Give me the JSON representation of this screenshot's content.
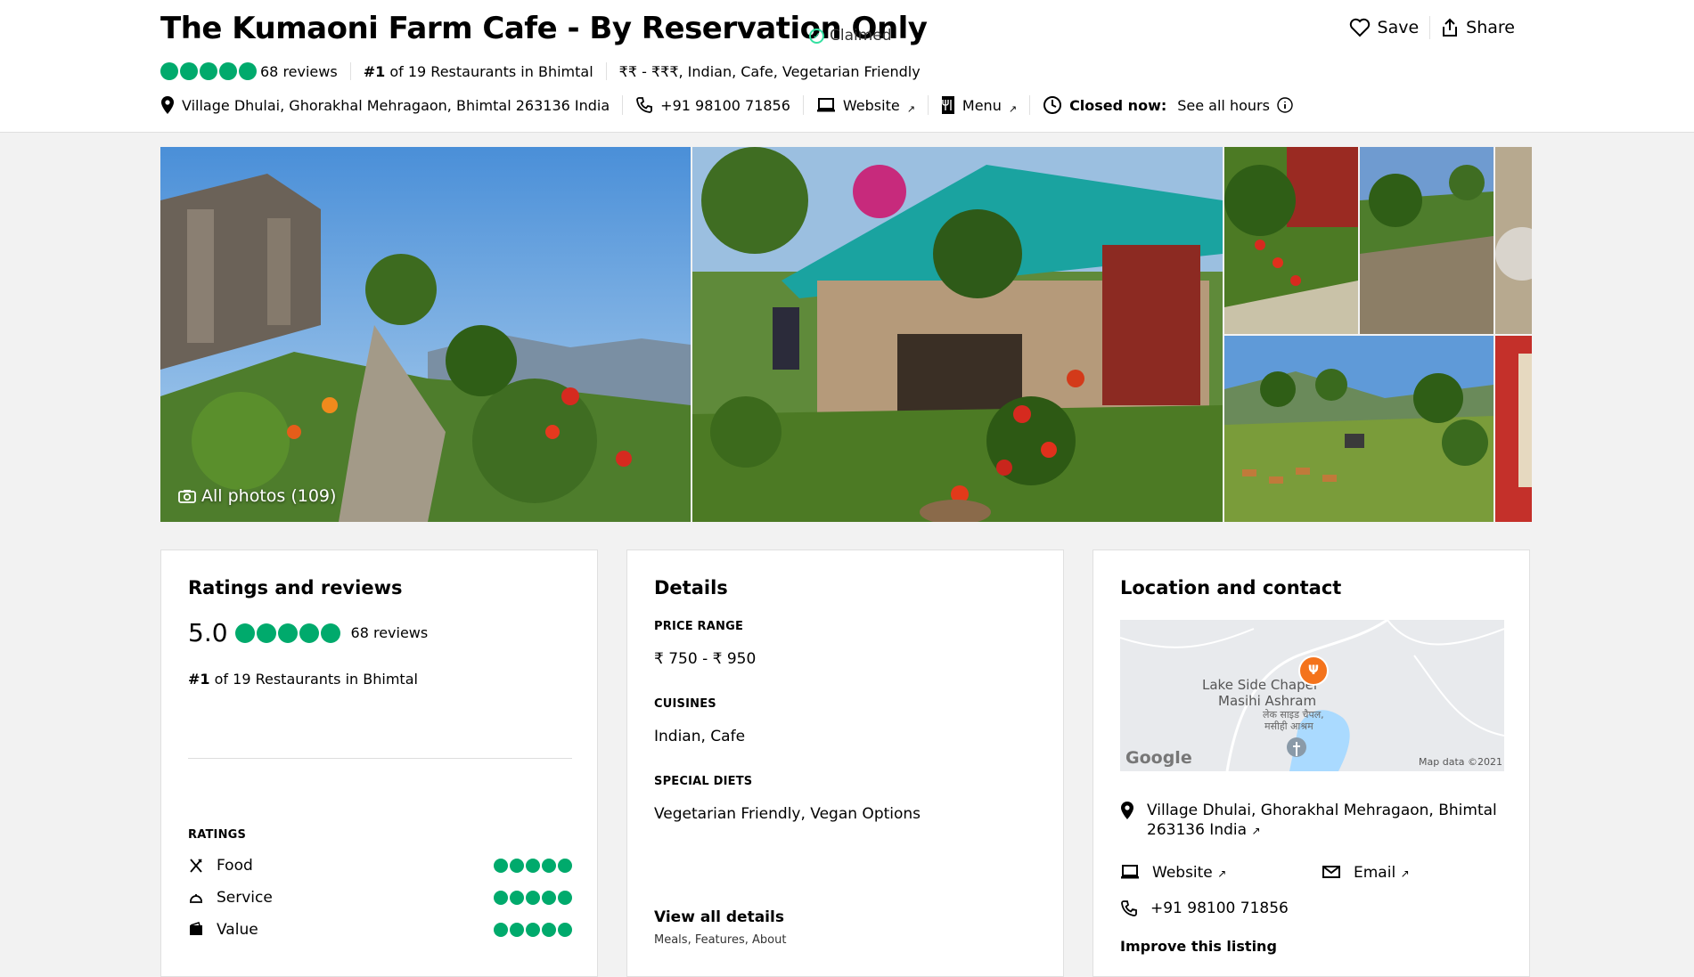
{
  "header": {
    "title": "The Kumaoni Farm Cafe - By Reservation Only",
    "claimed": "Claimed",
    "save": "Save",
    "share": "Share",
    "reviews": "68 reviews",
    "rank_num": "#1",
    "rank_text": " of 19 Restaurants in Bhimtal",
    "price_cuisine": "₹₹ - ₹₹₹, Indian, Cafe, Vegetarian Friendly",
    "address": "Village Dhulai, Ghorakhal Mehragaon, Bhimtal 263136 India",
    "phone": "+91 98100 71856",
    "website": "Website",
    "menu": "Menu",
    "closed": "Closed now:",
    "hours": "See all hours"
  },
  "gallery": {
    "all_photos": "All photos (109)"
  },
  "ratings_card": {
    "title": "Ratings and reviews",
    "score": "5.0",
    "reviews": "68 reviews",
    "rank_num": "#1",
    "rank_text": " of 19 Restaurants in Bhimtal",
    "ratings_label": "RATINGS",
    "items": [
      {
        "label": "Food",
        "value": 5
      },
      {
        "label": "Service",
        "value": 5
      },
      {
        "label": "Value",
        "value": 5
      }
    ]
  },
  "details_card": {
    "title": "Details",
    "price_label": "PRICE RANGE",
    "price_value": "₹ 750 - ₹ 950",
    "cuisines_label": "CUISINES",
    "cuisines_value": "Indian, Cafe",
    "diets_label": "SPECIAL DIETS",
    "diets_value": "Vegetarian Friendly, Vegan Options",
    "view_all": "View all details",
    "view_all_sub": "Meals, Features, About"
  },
  "location_card": {
    "title": "Location and contact",
    "map_label1": "Lake Side Chapel",
    "map_label2": "Masihi Ashram",
    "map_label3": "लेक साइड चैपल,",
    "map_label4": "मसीही आश्रम",
    "google": "Google",
    "map_data": "Map data ©2021",
    "address_line1": "Village Dhulai, Ghorakhal Mehragaon, Bhimtal",
    "address_line2": "263136 India",
    "website": "Website",
    "email": "Email",
    "phone": "+91 98100 71856",
    "improve": "Improve this listing"
  },
  "colors": {
    "bubble": "#00aa6c",
    "claimed": "#34e0a1"
  }
}
